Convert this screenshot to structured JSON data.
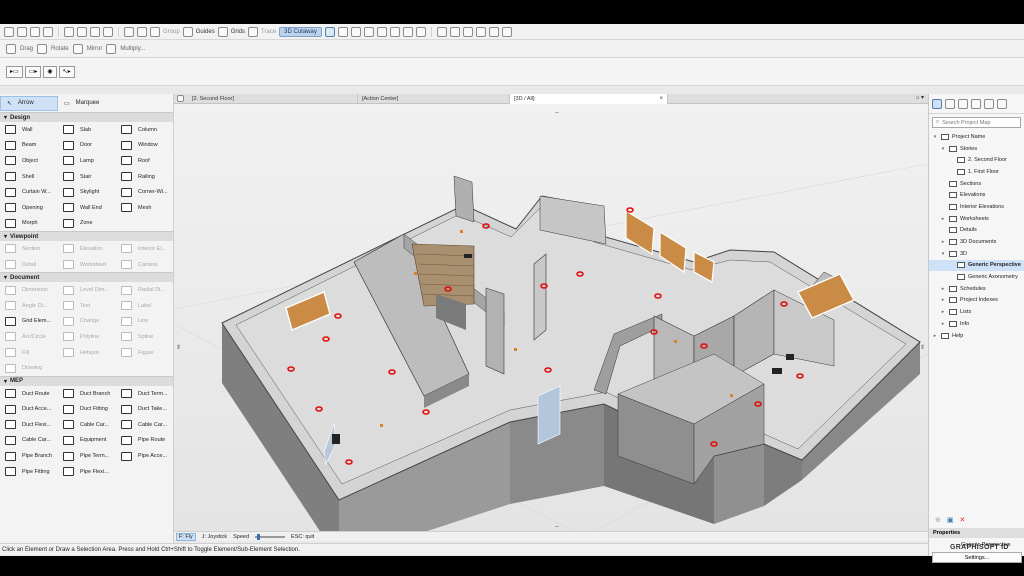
{
  "toolbar": {
    "group_label": "Group",
    "guides_label": "Guides",
    "grids_label": "Grids",
    "trace_label": "Trace",
    "cutaway_label": "3D Cutaway",
    "drag_label": "Drag",
    "rotate_label": "Rotate",
    "mirror_label": "Mirror",
    "multiply_label": "Multiply..."
  },
  "toolbox": {
    "arrow_label": "Arrow",
    "marquee_label": "Marquee",
    "sections": [
      {
        "title": "Design",
        "tools": [
          {
            "label": "Wall",
            "dim": false
          },
          {
            "label": "Slab",
            "dim": false
          },
          {
            "label": "Column",
            "dim": false
          },
          {
            "label": "Beam",
            "dim": false
          },
          {
            "label": "Door",
            "dim": false
          },
          {
            "label": "Window",
            "dim": false
          },
          {
            "label": "Object",
            "dim": false
          },
          {
            "label": "Lamp",
            "dim": false
          },
          {
            "label": "Roof",
            "dim": false
          },
          {
            "label": "Shell",
            "dim": false
          },
          {
            "label": "Stair",
            "dim": false
          },
          {
            "label": "Railing",
            "dim": false
          },
          {
            "label": "Curtain W...",
            "dim": false
          },
          {
            "label": "Skylight",
            "dim": false
          },
          {
            "label": "Corner-Wi...",
            "dim": false
          },
          {
            "label": "Opening",
            "dim": false
          },
          {
            "label": "Wall End",
            "dim": false
          },
          {
            "label": "Mesh",
            "dim": false
          },
          {
            "label": "Morph",
            "dim": false
          },
          {
            "label": "Zone",
            "dim": false
          }
        ]
      },
      {
        "title": "Viewpoint",
        "tools": [
          {
            "label": "Section",
            "dim": true
          },
          {
            "label": "Elevation",
            "dim": true
          },
          {
            "label": "Interior El...",
            "dim": true
          },
          {
            "label": "Detail",
            "dim": true
          },
          {
            "label": "Worksheet",
            "dim": true
          },
          {
            "label": "Camera",
            "dim": true
          }
        ]
      },
      {
        "title": "Document",
        "tools": [
          {
            "label": "Dimension",
            "dim": true
          },
          {
            "label": "Level Dim...",
            "dim": true
          },
          {
            "label": "Radial Di...",
            "dim": true
          },
          {
            "label": "Angle Di...",
            "dim": true
          },
          {
            "label": "Text",
            "dim": true
          },
          {
            "label": "Label",
            "dim": true
          },
          {
            "label": "Grid Elem...",
            "dim": false
          },
          {
            "label": "Change",
            "dim": true
          },
          {
            "label": "Line",
            "dim": true
          },
          {
            "label": "Arc/Circle",
            "dim": true
          },
          {
            "label": "Polyline",
            "dim": true
          },
          {
            "label": "Spline",
            "dim": true
          },
          {
            "label": "Fill",
            "dim": true
          },
          {
            "label": "Hotspot",
            "dim": true
          },
          {
            "label": "Figure",
            "dim": true
          },
          {
            "label": "Drawing",
            "dim": true
          }
        ]
      },
      {
        "title": "MEP",
        "tools": [
          {
            "label": "Duct Route",
            "dim": false
          },
          {
            "label": "Duct Branch",
            "dim": false
          },
          {
            "label": "Duct Term...",
            "dim": false
          },
          {
            "label": "Duct Acce...",
            "dim": false
          },
          {
            "label": "Duct Fitting",
            "dim": false
          },
          {
            "label": "Duct Take...",
            "dim": false
          },
          {
            "label": "Duct Flexi...",
            "dim": false
          },
          {
            "label": "Cable Car...",
            "dim": false
          },
          {
            "label": "Cable Car...",
            "dim": false
          },
          {
            "label": "Cable Car...",
            "dim": false
          },
          {
            "label": "Equipment",
            "dim": false
          },
          {
            "label": "Pipe Route",
            "dim": false
          },
          {
            "label": "Pipe Branch",
            "dim": false
          },
          {
            "label": "Pipe Term...",
            "dim": false
          },
          {
            "label": "Pipe Acce...",
            "dim": false
          },
          {
            "label": "Pipe Fitting",
            "dim": false
          },
          {
            "label": "Pipe Flexi...",
            "dim": false
          }
        ]
      }
    ]
  },
  "tabs": [
    {
      "label": "[2. Second Floor]"
    },
    {
      "label": "[Action Center]"
    },
    {
      "label": "[3D / All]"
    }
  ],
  "nav_bar": {
    "fly": "F: Fly",
    "joystick": "J: Joystick",
    "speed": "Speed",
    "esc": "ESC: quit"
  },
  "status_text": "Click an Element or Draw a Selection Area. Press and Hold Ctrl+Shift to Toggle Element/Sub-Element Selection.",
  "navigator": {
    "search_placeholder": "Search Project Map",
    "items": [
      {
        "label": "Project Name",
        "level": 0,
        "arrow": "v",
        "selected": false
      },
      {
        "label": "Stories",
        "level": 1,
        "arrow": "v",
        "selected": false
      },
      {
        "label": "2. Second Floor",
        "level": 2,
        "arrow": "",
        "selected": false
      },
      {
        "label": "1. First Floor",
        "level": 2,
        "arrow": "",
        "selected": false
      },
      {
        "label": "Sections",
        "level": 1,
        "arrow": "",
        "selected": false
      },
      {
        "label": "Elevations",
        "level": 1,
        "arrow": "",
        "selected": false
      },
      {
        "label": "Interior Elevations",
        "level": 1,
        "arrow": "",
        "selected": false
      },
      {
        "label": "Worksheets",
        "level": 1,
        "arrow": ">",
        "selected": false
      },
      {
        "label": "Details",
        "level": 1,
        "arrow": "",
        "selected": false
      },
      {
        "label": "3D Documents",
        "level": 1,
        "arrow": ">",
        "selected": false
      },
      {
        "label": "3D",
        "level": 1,
        "arrow": "v",
        "selected": false
      },
      {
        "label": "Generic Perspective",
        "level": 2,
        "arrow": "",
        "selected": true
      },
      {
        "label": "Generic Axonometry",
        "level": 2,
        "arrow": "",
        "selected": false
      },
      {
        "label": "Schedules",
        "level": 1,
        "arrow": ">",
        "selected": false
      },
      {
        "label": "Project Indexes",
        "level": 1,
        "arrow": ">",
        "selected": false
      },
      {
        "label": "Lists",
        "level": 1,
        "arrow": ">",
        "selected": false
      },
      {
        "label": "Info",
        "level": 1,
        "arrow": ">",
        "selected": false
      },
      {
        "label": "Help",
        "level": 0,
        "arrow": ">",
        "selected": false
      }
    ],
    "properties_label": "Properties",
    "properties_value": "Generic Perspective",
    "settings_label": "Settings..."
  },
  "logo_text": "GRAPHISOFT ID"
}
